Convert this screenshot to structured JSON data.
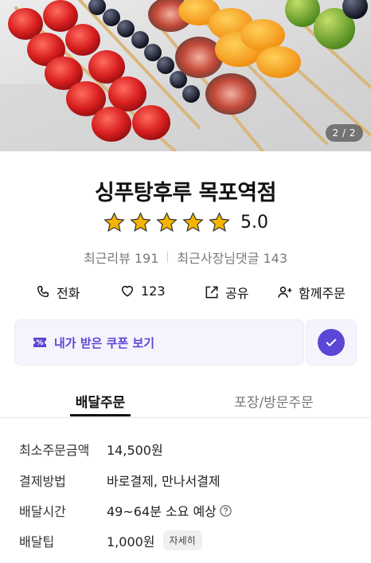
{
  "hero": {
    "page_indicator": "2 / 2"
  },
  "store": {
    "name": "싱푸탕후루 목포역점",
    "rating": "5.0",
    "stars": 5,
    "recent_reviews_label": "최근리뷰",
    "recent_reviews_count": "191",
    "owner_replies_label": "최근사장님댓글",
    "owner_replies_count": "143"
  },
  "actions": {
    "call": "전화",
    "likes": "123",
    "share": "공유",
    "group_order": "함께주문"
  },
  "coupon": {
    "label": "내가 받은 쿠폰 보기"
  },
  "tabs": {
    "delivery": "배달주문",
    "pickup": "포장/방문주문"
  },
  "info": {
    "min_order_label": "최소주문금액",
    "min_order_value": "14,500원",
    "payment_label": "결제방법",
    "payment_value": "바로결제, 만나서결제",
    "delivery_time_label": "배달시간",
    "delivery_time_value": "49~64분 소요 예상",
    "delivery_tip_label": "배달팁",
    "delivery_tip_value": "1,000원",
    "delivery_tip_detail": "자세히"
  },
  "colors": {
    "accent": "#5b47d6",
    "star": "#f5b400",
    "coupon_bg": "#f5f4fc"
  }
}
